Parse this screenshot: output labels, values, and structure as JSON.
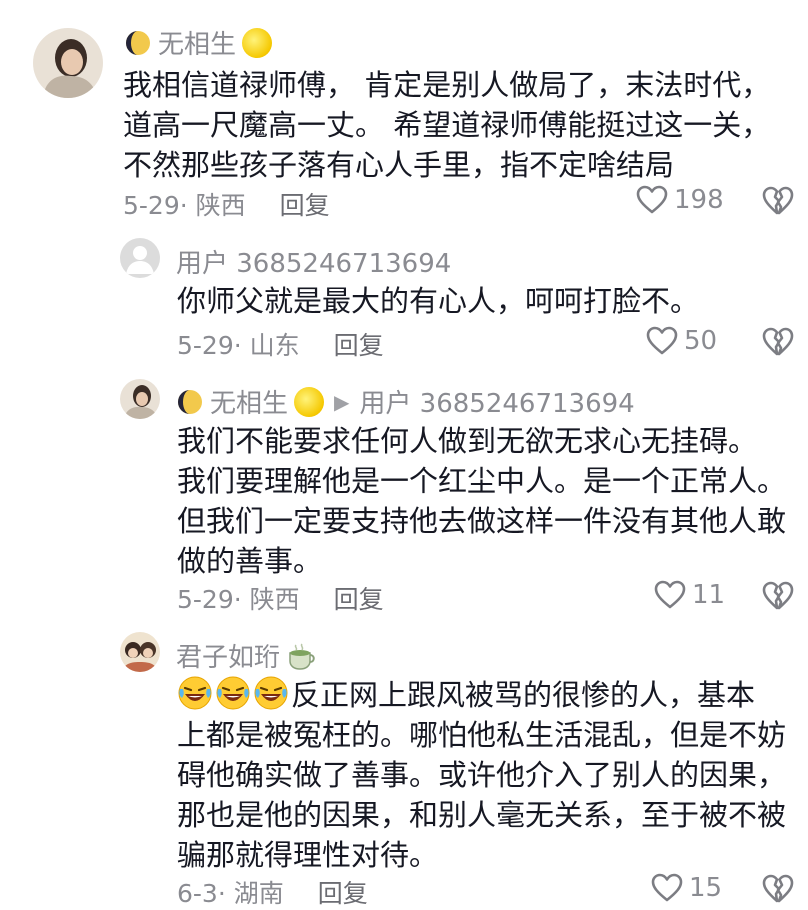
{
  "comments": [
    {
      "user": "无相生",
      "lines": [
        "我相信道禄师傅， 肯定是别人做局了，末法时代，",
        "道高一尺魔高一丈。 希望道禄师傅能挺过这一关，",
        "不然那些孩子落有心人手里，指不定啥结局"
      ],
      "date_loc": "5-29· 陕西",
      "reply_label": "回复",
      "likes": "198"
    },
    {
      "user": "用户 3685246713694",
      "lines": [
        "你师父就是最大的有心人，呵呵打脸不。"
      ],
      "date_loc": "5-29· 山东",
      "reply_label": "回复",
      "likes": "50"
    },
    {
      "user": "无相生",
      "reply_to": "用户 3685246713694",
      "lines": [
        "我们不能要求任何人做到无欲无求心无挂碍。",
        "我们要理解他是一个红尘中人。是一个正常人。",
        "但我们一定要支持他去做这样一件没有其他人敢",
        "做的善事。"
      ],
      "date_loc": "5-29· 陕西",
      "reply_label": "回复",
      "likes": "11"
    },
    {
      "user": "君子如珩",
      "lines": [
        "反正网上跟风被骂的很惨的人，基本",
        "上都是被冤枉的。哪怕他私生活混乱，但是不妨",
        "碍他确实做了善事。或许他介入了别人的因果，",
        "那也是他的因果，和别人毫无关系，至于被不被",
        "骗那就得理性对待。"
      ],
      "date_loc": "6-3· 湖南",
      "reply_label": "回复",
      "likes": "15"
    }
  ],
  "icons": {
    "like": "heart-outline-icon",
    "dislike": "broken-heart-icon"
  }
}
